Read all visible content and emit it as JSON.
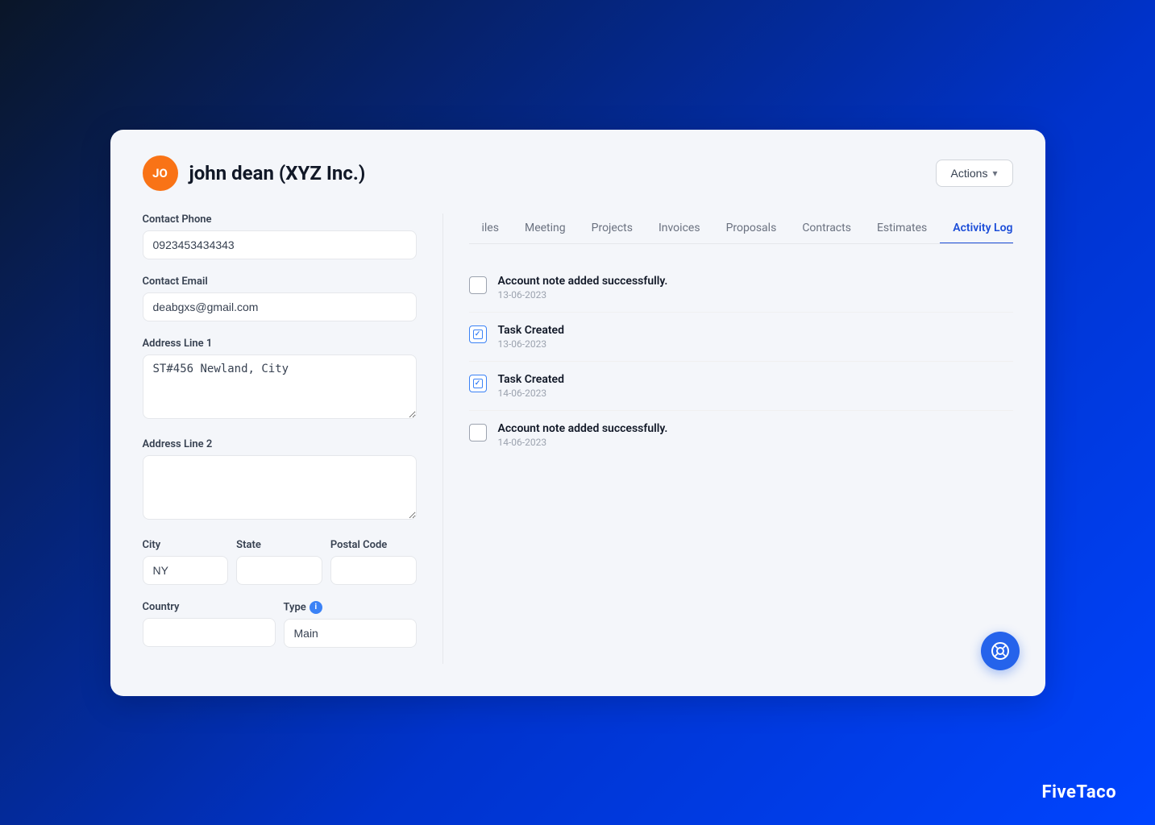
{
  "branding": "FiveTaco",
  "header": {
    "avatar_initials": "JO",
    "contact_name": "john dean (XYZ Inc.)",
    "actions_label": "Actions"
  },
  "form": {
    "contact_phone_label": "Contact Phone",
    "contact_phone_value": "0923453434343",
    "contact_email_label": "Contact Email",
    "contact_email_value": "deabgxs@gmail.com",
    "address_line1_label": "Address Line 1",
    "address_line1_value": "ST#456 Newland, City",
    "address_line2_label": "Address Line 2",
    "address_line2_value": "",
    "city_label": "City",
    "city_value": "NY",
    "state_label": "State",
    "state_value": "",
    "postal_code_label": "Postal Code",
    "postal_code_value": "",
    "country_label": "Country",
    "country_value": "",
    "type_label": "Type",
    "type_info": "i",
    "type_value": "Main"
  },
  "tabs": [
    {
      "label": "iles",
      "active": false
    },
    {
      "label": "Meeting",
      "active": false
    },
    {
      "label": "Projects",
      "active": false
    },
    {
      "label": "Invoices",
      "active": false
    },
    {
      "label": "Proposals",
      "active": false
    },
    {
      "label": "Contracts",
      "active": false
    },
    {
      "label": "Estimates",
      "active": false
    },
    {
      "label": "Activity Log",
      "active": true
    }
  ],
  "activity_log": [
    {
      "icon_type": "note",
      "title": "Account note added successfully.",
      "date": "13-06-2023"
    },
    {
      "icon_type": "task",
      "title": "Task Created",
      "date": "13-06-2023"
    },
    {
      "icon_type": "task",
      "title": "Task Created",
      "date": "14-06-2023"
    },
    {
      "icon_type": "note",
      "title": "Account note added successfully.",
      "date": "14-06-2023"
    }
  ],
  "support_icon": "life-ring"
}
